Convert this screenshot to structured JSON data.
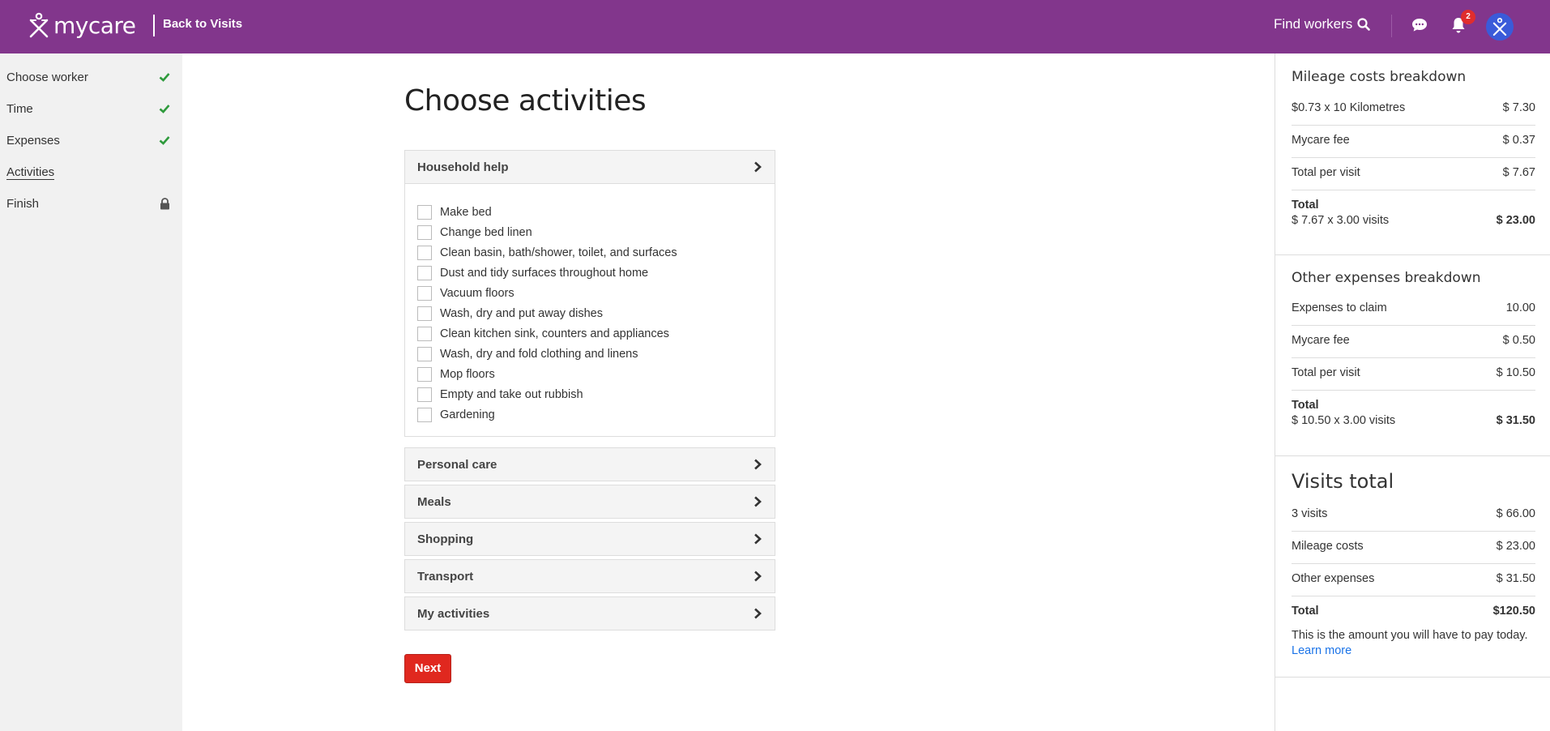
{
  "header": {
    "logo_text": "mycare",
    "back_label": "Back to Visits",
    "find_workers_label": "Find workers",
    "notification_count": "2",
    "brand_color": "#82368c"
  },
  "sidebar": {
    "steps": [
      {
        "label": "Choose worker",
        "status": "done"
      },
      {
        "label": "Time",
        "status": "done"
      },
      {
        "label": "Expenses",
        "status": "done"
      },
      {
        "label": "Activities",
        "status": "current"
      },
      {
        "label": "Finish",
        "status": "locked"
      }
    ]
  },
  "main": {
    "title": "Choose activities",
    "household": {
      "label": "Household help",
      "items": [
        "Make bed",
        "Change bed linen",
        "Clean basin, bath/shower, toilet, and surfaces",
        "Dust and tidy surfaces throughout home",
        "Vacuum floors",
        "Wash, dry and put away dishes",
        "Clean kitchen sink, counters and appliances",
        "Wash, dry and fold clothing and linens",
        "Mop floors",
        "Empty and take out rubbish",
        "Gardening"
      ]
    },
    "categories": [
      "Personal care",
      "Meals",
      "Shopping",
      "Transport",
      "My activities"
    ],
    "next_label": "Next"
  },
  "right": {
    "mileage": {
      "title": "Mileage costs breakdown",
      "rate_label": "$0.73 x 10 Kilometres",
      "rate_value": "$ 7.30",
      "fee_label": "Mycare fee",
      "fee_value": "$ 0.37",
      "per_visit_label": "Total per visit",
      "per_visit_value": "$ 7.67",
      "total_label": "Total",
      "total_detail": "$ 7.67 x 3.00 visits",
      "total_value": "$ 23.00"
    },
    "other": {
      "title": "Other expenses breakdown",
      "claim_label": "Expenses to claim",
      "claim_value": "10.00",
      "fee_label": "Mycare fee",
      "fee_value": "$ 0.50",
      "per_visit_label": "Total per visit",
      "per_visit_value": "$ 10.50",
      "total_label": "Total",
      "total_detail": "$ 10.50 x 3.00 visits",
      "total_value": "$ 31.50"
    },
    "visits": {
      "title": "Visits total",
      "visits_label": "3 visits",
      "visits_value": "$ 66.00",
      "mileage_label": "Mileage costs",
      "mileage_value": "$ 23.00",
      "other_label": "Other expenses",
      "other_value": "$ 31.50",
      "total_label": "Total",
      "total_value": "$120.50",
      "note": "This is the amount you will have to pay today.",
      "learn_more": "Learn more"
    }
  }
}
